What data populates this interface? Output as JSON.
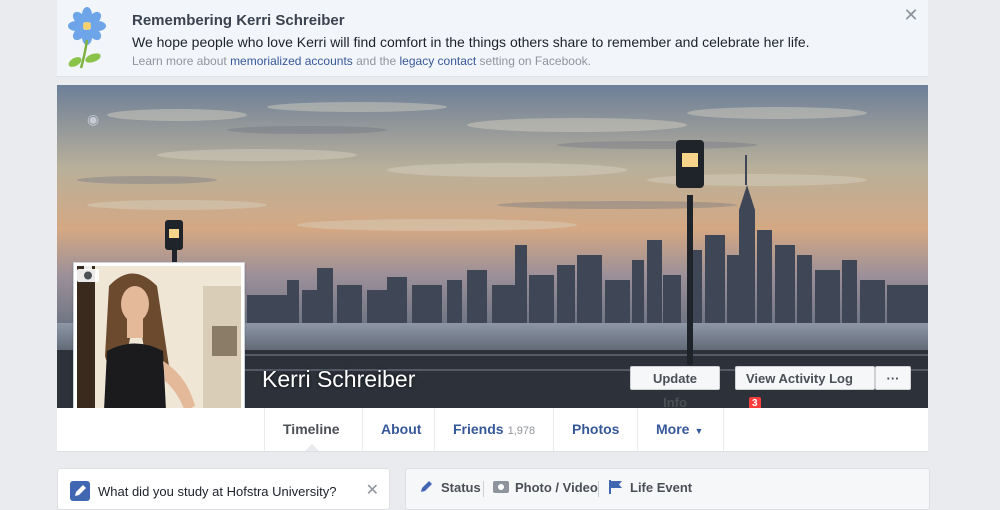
{
  "memorial": {
    "title": "Remembering Kerri Schreiber",
    "message": "We hope people who love Kerri will find comfort in the things others share to remember and celebrate her life.",
    "learn_prefix": "Learn more about ",
    "link1": "memorialized accounts",
    "middle": " and the ",
    "link2": "legacy contact",
    "suffix": " setting on Facebook.",
    "close_icon": "close-icon"
  },
  "profile": {
    "name": "Kerri Schreiber"
  },
  "actions": {
    "update_info": "Update Info",
    "view_activity_log": "View Activity Log",
    "activity_badge": "3",
    "more": "···"
  },
  "tabs": [
    {
      "label": "Timeline"
    },
    {
      "label": "About"
    },
    {
      "label": "Friends",
      "count": "1,978"
    },
    {
      "label": "Photos"
    },
    {
      "label": "More"
    }
  ],
  "study_prompt": {
    "question": "What did you study at Hofstra University?"
  },
  "composer": {
    "status": "Status",
    "photo_video": "Photo / Video",
    "life_event": "Life Event"
  },
  "colors": {
    "link": "#365899",
    "badge": "#fa3e3e",
    "accent": "#4267b2"
  }
}
